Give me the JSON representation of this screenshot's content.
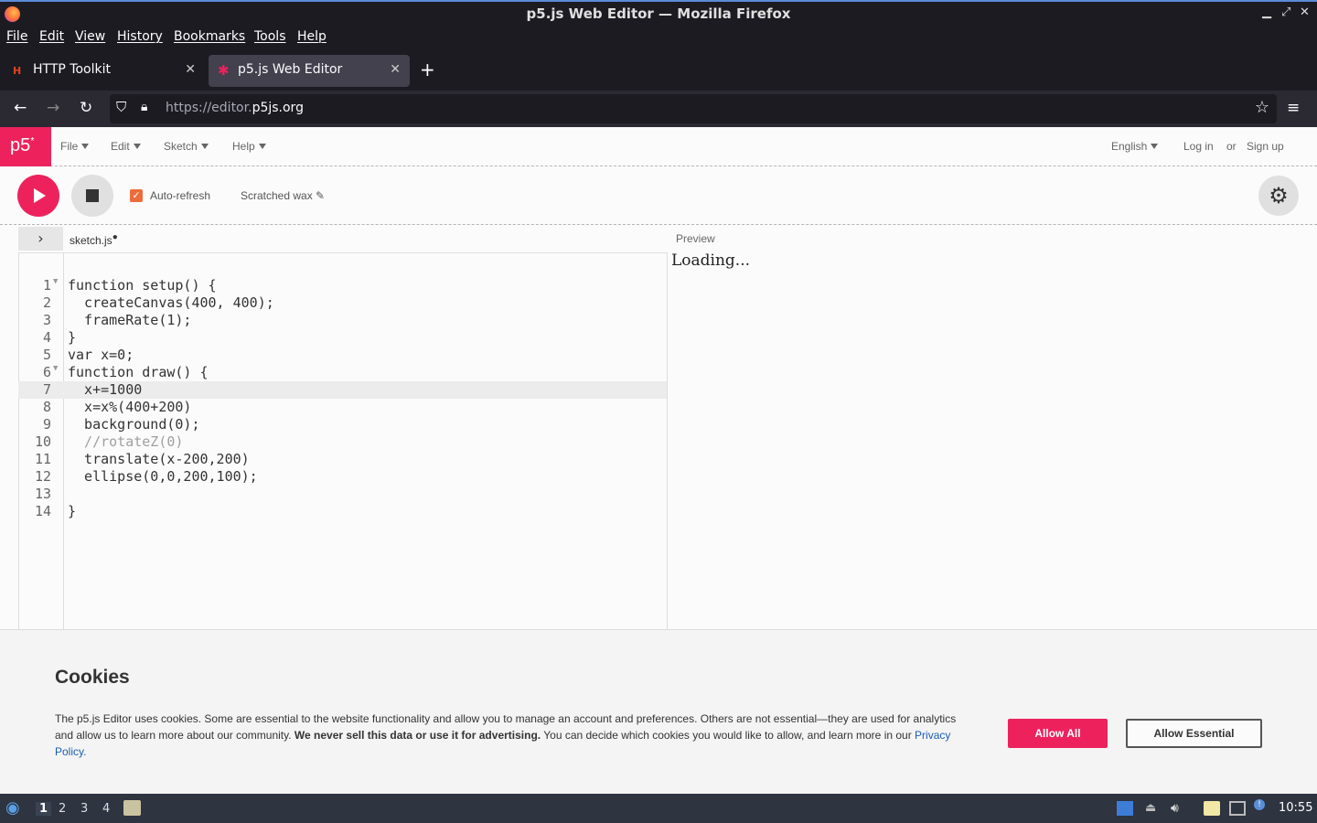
{
  "window": {
    "title": "p5.js Web Editor — Mozilla Firefox"
  },
  "menubar": [
    "File",
    "Edit",
    "View",
    "History",
    "Bookmarks",
    "Tools",
    "Help"
  ],
  "tabs": [
    {
      "label": "HTTP Toolkit",
      "icon": "http-toolkit-icon",
      "active": false
    },
    {
      "label": "p5.js Web Editor",
      "icon": "p5-star-icon",
      "active": true
    }
  ],
  "url": {
    "prefix": "https://editor.",
    "domain": "p5js.org"
  },
  "p5": {
    "logo": "p5",
    "menu": [
      "File",
      "Edit",
      "Sketch",
      "Help"
    ],
    "language": "English",
    "login": "Log in",
    "or": "or",
    "signup": "Sign up"
  },
  "toolbar": {
    "autorefresh_label": "Auto-refresh",
    "autorefresh_checked": true,
    "sketch_name": "Scratched wax"
  },
  "editor": {
    "filename": "sketch.js",
    "lines": [
      "function setup() {",
      "  createCanvas(400, 400);",
      "  frameRate(1);",
      "}",
      "var x=0;",
      "function draw() {",
      "  x+=1000",
      "  x=x%(400+200)",
      "  background(0);",
      "  //rotateZ(0)",
      "  translate(x-200,200)",
      "  ellipse(0,0,200,100);",
      "",
      "}"
    ],
    "active_line": 7
  },
  "preview": {
    "label": "Preview",
    "status": "Loading..."
  },
  "cookies": {
    "title": "Cookies",
    "text_1": "The p5.js Editor uses cookies. Some are essential to the website functionality and allow you to manage an account and preferences. Others are not essential—they are used for analytics and allow us to learn more about our community. ",
    "text_bold": "We never sell this data or use it for advertising.",
    "text_2": " You can decide which cookies you would like to allow, and learn more in our ",
    "link": "Privacy Policy.",
    "allow_all": "Allow All",
    "allow_essential": "Allow Essential"
  },
  "taskbar": {
    "workspaces": [
      "1",
      "2",
      "3",
      "4"
    ],
    "clock": "10:55"
  },
  "colors": {
    "accent": "#ed225d",
    "checkbox": "#ed6c3c"
  }
}
